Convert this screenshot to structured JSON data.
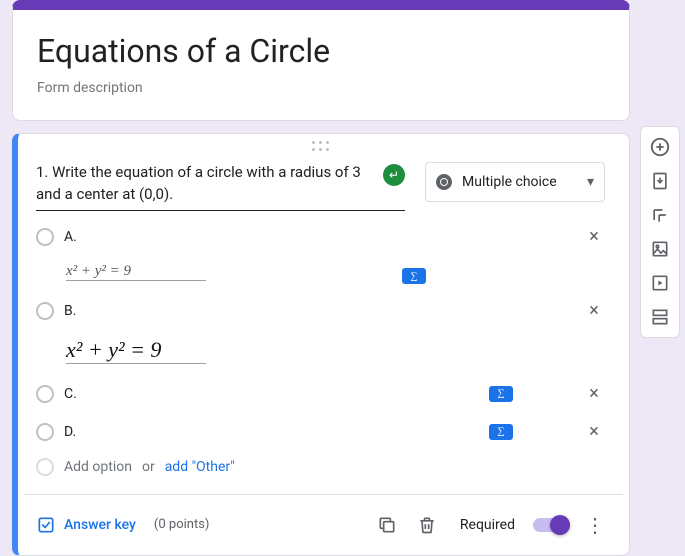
{
  "form": {
    "title": "Equations of a Circle",
    "description": "Form description"
  },
  "question": {
    "text": "1. Write the equation of a circle with a radius of 3 and a center at (0,0).",
    "type": "Multiple choice",
    "options": {
      "a": {
        "label": "A.",
        "equation": "x² + y² = 9",
        "has_eq_badge": false
      },
      "b": {
        "label": "B.",
        "equation": "x² + y²  = 9",
        "has_eq_badge": false
      },
      "c": {
        "label": "C.",
        "equation": "",
        "has_eq_badge": true
      },
      "d": {
        "label": "D.",
        "equation": "",
        "has_eq_badge": true
      }
    },
    "add_option_text": "Add option",
    "add_or": "or",
    "add_other": "add \"Other\""
  },
  "footer": {
    "answer_key": "Answer key",
    "points": "(0 points)",
    "required": "Required",
    "required_on": true
  },
  "icons": {
    "eq_badge": "∑",
    "enter": "↵",
    "close": "×",
    "dropdown": "▾",
    "more": "⋮"
  }
}
